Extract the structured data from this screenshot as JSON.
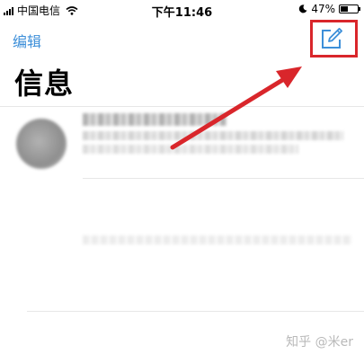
{
  "status_bar": {
    "carrier": "中国电信",
    "time": "下午11:46",
    "battery_percent": "47%",
    "battery_level": 0.47
  },
  "nav": {
    "edit_label": "编辑",
    "compose_icon": "compose-icon"
  },
  "title": "信息",
  "annotation": {
    "highlight_color": "#d9262b",
    "arrow_color": "#d9262b"
  },
  "watermark": "知乎 @米er"
}
